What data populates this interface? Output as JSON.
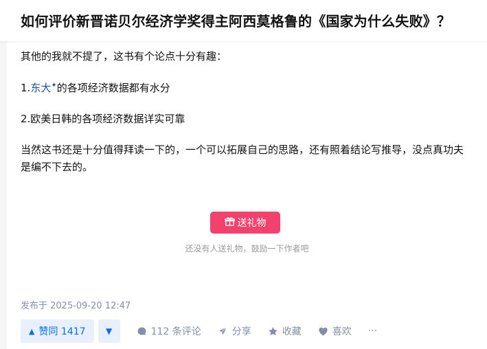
{
  "header": {
    "question_title": "如何评价新晋诺贝尔经济学奖得主阿西莫格鲁的《国家为什么失败》？"
  },
  "answer": {
    "paragraphs": {
      "p1": "其他的我就不提了，这书有个论点十分有趣：",
      "p2_prefix": "1.",
      "p2_link": "东大",
      "p2_link_sup": "✦",
      "p2_suffix": "的各项经济数据都有水分",
      "p3": "2.欧美日韩的各项经济数据详实可靠",
      "p4_line1": "当然这书还是十分值得拜读一下的，一个可以拓展自己的思路，还有照着结论写推导，没点真功夫",
      "p4_line2": "是编不下去的。"
    },
    "gift": {
      "button_label": "送礼物",
      "hint": "还没有人送礼物，鼓励一下作者吧"
    },
    "published": "发布于 2025-09-20 12:47"
  },
  "actions": {
    "vote_up_label": "赞同 1417",
    "vote_down_glyph": "▼",
    "vote_up_glyph": "▲",
    "comments_label": "112 条评论",
    "share_label": "分享",
    "favorite_label": "收藏",
    "like_label": "喜欢",
    "more_glyph": "···"
  },
  "colors": {
    "accent": "#056de8",
    "gift_button": "#f1416c",
    "link": "#175199",
    "muted": "#8590a6"
  }
}
